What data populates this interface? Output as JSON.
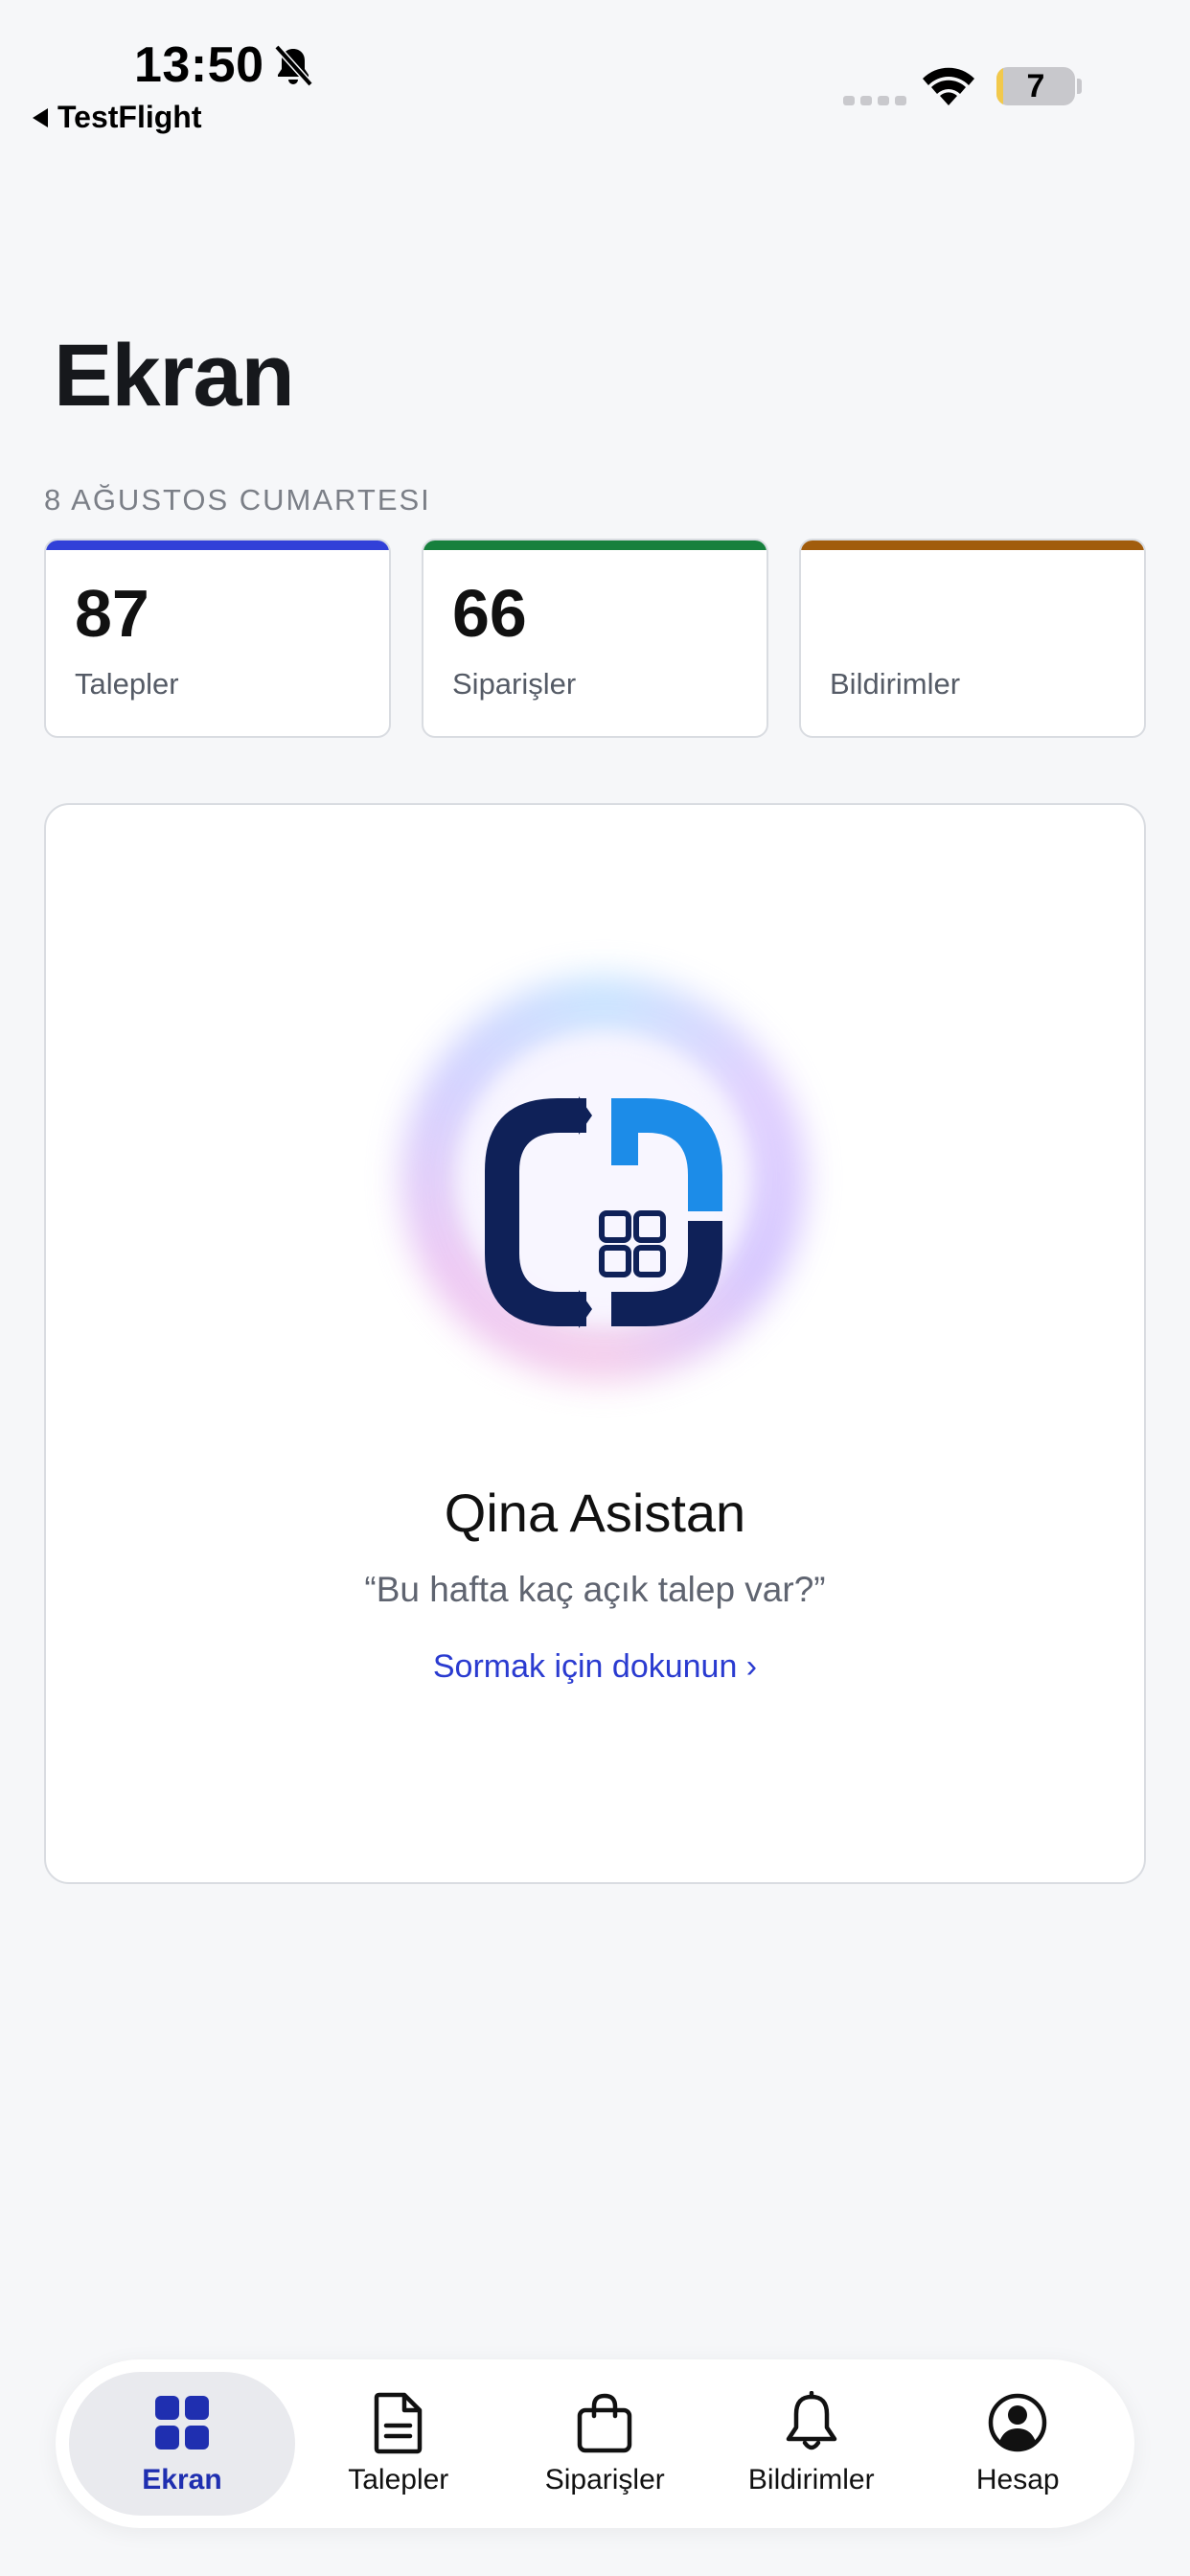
{
  "status_bar": {
    "time": "13:50",
    "back_label": "TestFlight",
    "battery_level": 7,
    "battery_text": "7",
    "bell_icon": "bell-slash-icon",
    "wifi_icon": "wifi-icon"
  },
  "header": {
    "title": "Ekran",
    "date": "8 AĞUSTOS CUMARTESI"
  },
  "stats": [
    {
      "value": "87",
      "label": "Talepler",
      "color": "#3140d8"
    },
    {
      "value": "66",
      "label": "Siparişler",
      "color": "#17803d"
    },
    {
      "value": "",
      "label": "Bildirimler",
      "color": "#a15c0c"
    }
  ],
  "assistant": {
    "title": "Qina Asistan",
    "quote": "“Bu hafta kaç açık talep var?”",
    "cta": "Sormak için dokunun ›",
    "logo_colors": {
      "dark": "#0f2158",
      "light": "#1c8ce8"
    }
  },
  "tabs": [
    {
      "label": "Ekran",
      "icon": "grid-icon",
      "active": true
    },
    {
      "label": "Talepler",
      "icon": "document-icon",
      "active": false
    },
    {
      "label": "Siparişler",
      "icon": "bag-icon",
      "active": false
    },
    {
      "label": "Bildirimler",
      "icon": "bell-icon",
      "active": false
    },
    {
      "label": "Hesap",
      "icon": "profile-icon",
      "active": false
    }
  ],
  "colors": {
    "accent": "#1f2fb0",
    "background": "#f6f7f9"
  }
}
